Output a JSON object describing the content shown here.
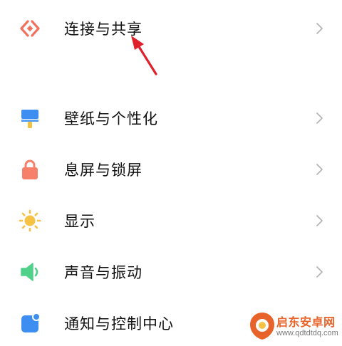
{
  "settings": {
    "items": [
      {
        "label": "连接与共享",
        "icon": "connection-sharing-icon",
        "color": "#f0735e"
      },
      {
        "label": "壁纸与个性化",
        "icon": "wallpaper-personalization-icon",
        "color": "#3d8ef0"
      },
      {
        "label": "息屏与锁屏",
        "icon": "lock-screen-icon",
        "color": "#f6806a"
      },
      {
        "label": "显示",
        "icon": "display-sun-icon",
        "color": "#f6c244"
      },
      {
        "label": "声音与振动",
        "icon": "sound-vibration-icon",
        "color": "#4fd18a"
      },
      {
        "label": "通知与控制中心",
        "icon": "notification-control-icon",
        "color": "#3d8ef0"
      }
    ],
    "chevron_icon": "chevron-right-icon"
  },
  "annotation": {
    "icon": "red-pointer-arrow-icon",
    "color": "#e0202a"
  },
  "watermark": {
    "title": "启东安卓网",
    "url": "www.qdtdtdq.com",
    "title_color": "#e8632a"
  }
}
